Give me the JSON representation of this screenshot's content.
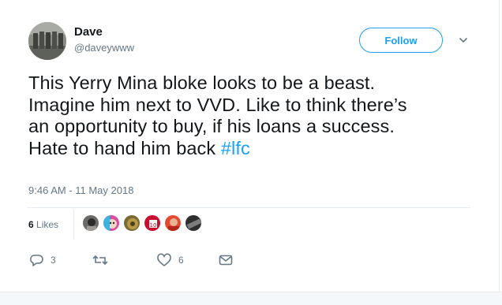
{
  "author": {
    "name": "Dave",
    "handle": "@daveywww",
    "avatar_icon": "profile-photo"
  },
  "follow_button": {
    "label": "Follow",
    "color": "#1da1f2"
  },
  "more_menu": {
    "icon": "chevron-down-icon"
  },
  "tweet": {
    "lines": [
      "This Yerry Mina bloke looks to be a beast.",
      "Imagine him next to VVD. Like to think there’s",
      "an opportunity to buy, if his loans a success.",
      "Hate to hand him back "
    ],
    "hashtag": "#lfc",
    "hashtag_color": "#1da1f2"
  },
  "timestamp": "9:46 AM - 11 May 2018",
  "stats": {
    "likes_count": "6",
    "likes_label": "Likes",
    "liker_avatars": [
      "avatar-1",
      "avatar-2",
      "avatar-3",
      "avatar-4",
      "avatar-5",
      "avatar-6"
    ]
  },
  "actions": {
    "reply_count": "3",
    "retweet_count": "",
    "like_count": "6",
    "icons": [
      "reply-icon",
      "retweet-icon",
      "like-icon",
      "message-icon"
    ]
  }
}
